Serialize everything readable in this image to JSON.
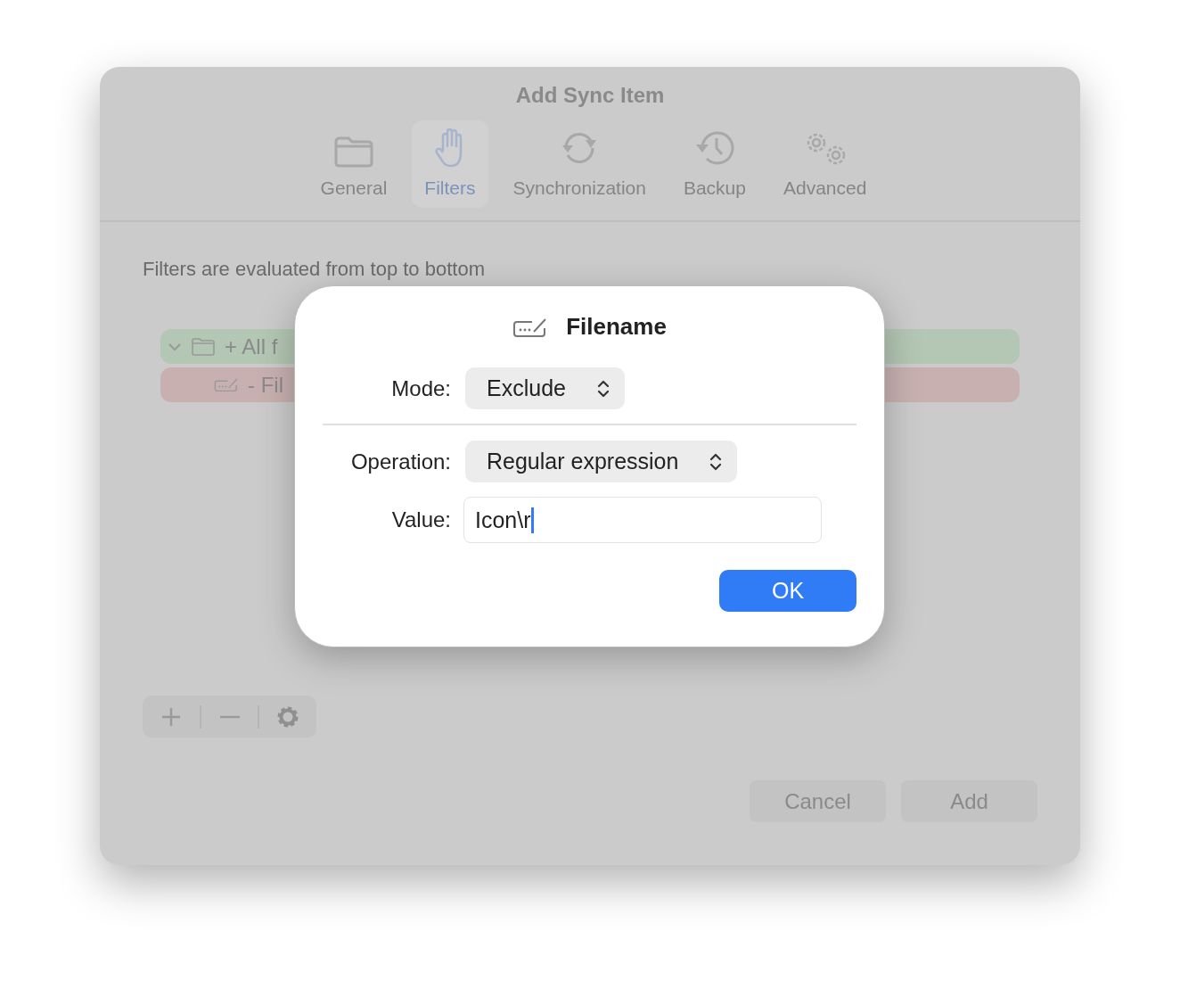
{
  "window": {
    "title": "Add Sync Item"
  },
  "tabs": [
    {
      "label": "General",
      "selected": false
    },
    {
      "label": "Filters",
      "selected": true
    },
    {
      "label": "Synchronization",
      "selected": false
    },
    {
      "label": "Backup",
      "selected": false
    },
    {
      "label": "Advanced",
      "selected": false
    }
  ],
  "description": "Filters are evaluated from top to bottom",
  "filters": [
    {
      "text": "+ All f",
      "color": "#b4c6b4",
      "expanded": true,
      "children": [
        {
          "text": "- Fil",
          "color": "#c8b0b0"
        }
      ]
    }
  ],
  "buttons": [
    "Cancel",
    "Add"
  ],
  "dialog": {
    "title": "Filename",
    "mode": {
      "label": "Mode:",
      "value": "Exclude"
    },
    "operation": {
      "label": "Operation:",
      "value": "Regular expression"
    },
    "value": {
      "label": "Value:",
      "value": "Icon\\r",
      "focused": true
    },
    "buttons": [
      "OK"
    ]
  }
}
